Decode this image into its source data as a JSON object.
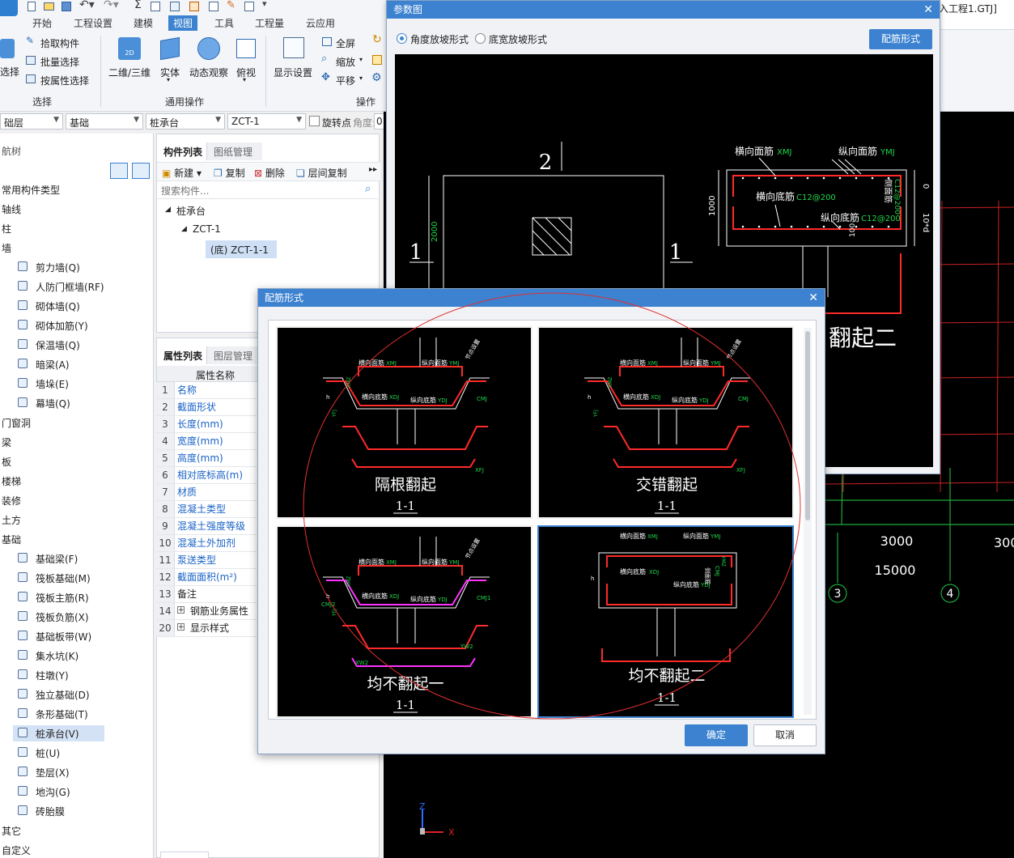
{
  "quick_access": {
    "sigma": "Σ"
  },
  "file_title": "入工程1.GTJ]",
  "tabs": [
    "开始",
    "工程设置",
    "建模",
    "视图",
    "工具",
    "工程量",
    "云应用"
  ],
  "active_tab_index": 3,
  "ribbon": {
    "select_btn": "选择",
    "pick": "拾取构件",
    "batch": "批量选择",
    "by_attr": "按属性选择",
    "group_select": "选择",
    "view_2d3d": "二维/三维",
    "solid": "实体",
    "orbit": "动态观察",
    "top_view": "俯视",
    "group_common": "通用操作",
    "display_settings": "显示设置",
    "fullscreen": "全屏",
    "zoom": "缩放",
    "pan": "平移",
    "group_ops": "操作",
    "icon_2d": "2D"
  },
  "combos": {
    "floor": "础层",
    "category": "基础",
    "type": "桩承台",
    "element": "ZCT-1",
    "rotate_label": "旋转点",
    "angle_label": "角度:",
    "angle_value": "0"
  },
  "nav_tree": {
    "title": "航树",
    "items": [
      {
        "label": "常用构件类型",
        "level": 0
      },
      {
        "label": "轴线",
        "level": 0
      },
      {
        "label": "柱",
        "level": 0
      },
      {
        "label": "墙",
        "level": 0
      },
      {
        "label": "剪力墙(Q)",
        "level": 1
      },
      {
        "label": "人防门框墙(RF)",
        "level": 1
      },
      {
        "label": "砌体墙(Q)",
        "level": 1
      },
      {
        "label": "砌体加筋(Y)",
        "level": 1
      },
      {
        "label": "保温墙(Q)",
        "level": 1
      },
      {
        "label": "暗梁(A)",
        "level": 1
      },
      {
        "label": "墙垛(E)",
        "level": 1
      },
      {
        "label": "幕墙(Q)",
        "level": 1
      },
      {
        "label": "门窗洞",
        "level": 0
      },
      {
        "label": "梁",
        "level": 0
      },
      {
        "label": "板",
        "level": 0
      },
      {
        "label": "楼梯",
        "level": 0
      },
      {
        "label": "装修",
        "level": 0
      },
      {
        "label": "土方",
        "level": 0
      },
      {
        "label": "基础",
        "level": 0
      },
      {
        "label": "基础梁(F)",
        "level": 1
      },
      {
        "label": "筏板基础(M)",
        "level": 1
      },
      {
        "label": "筏板主筋(R)",
        "level": 1
      },
      {
        "label": "筏板负筋(X)",
        "level": 1
      },
      {
        "label": "基础板带(W)",
        "level": 1
      },
      {
        "label": "集水坑(K)",
        "level": 1
      },
      {
        "label": "柱墩(Y)",
        "level": 1
      },
      {
        "label": "独立基础(D)",
        "level": 1
      },
      {
        "label": "条形基础(T)",
        "level": 1
      },
      {
        "label": "桩承台(V)",
        "level": 1
      },
      {
        "label": "桩(U)",
        "level": 1
      },
      {
        "label": "垫层(X)",
        "level": 1
      },
      {
        "label": "地沟(G)",
        "level": 1
      },
      {
        "label": "砖胎膜",
        "level": 1
      },
      {
        "label": "其它",
        "level": 0
      },
      {
        "label": "自定义",
        "level": 0
      }
    ],
    "selected_index": 28
  },
  "component_panel": {
    "tab_list": "构件列表",
    "tab_drawings": "图纸管理",
    "new": "新建",
    "copy": "复制",
    "delete": "删除",
    "floor_copy": "层间复制",
    "search_placeholder": "搜索构件...",
    "tree_root": "桩承台",
    "tree_child": "ZCT-1",
    "tree_leaf": "(底) ZCT-1-1"
  },
  "prop_panel": {
    "tab_props": "属性列表",
    "tab_layers": "图层管理",
    "header": "属性名称",
    "rows": [
      {
        "num": "1",
        "name": "名称",
        "link": true
      },
      {
        "num": "2",
        "name": "截面形状",
        "link": true
      },
      {
        "num": "3",
        "name": "长度(mm)",
        "link": true
      },
      {
        "num": "4",
        "name": "宽度(mm)",
        "link": true
      },
      {
        "num": "5",
        "name": "高度(mm)",
        "link": true
      },
      {
        "num": "6",
        "name": "相对底标高(m)",
        "link": true
      },
      {
        "num": "7",
        "name": "材质",
        "link": true
      },
      {
        "num": "8",
        "name": "混凝土类型",
        "link": true
      },
      {
        "num": "9",
        "name": "混凝土强度等级",
        "link": true
      },
      {
        "num": "10",
        "name": "混凝土外加剂",
        "link": true
      },
      {
        "num": "11",
        "name": "泵送类型",
        "link": true
      },
      {
        "num": "12",
        "name": "截面面积(m²)",
        "link": true
      },
      {
        "num": "13",
        "name": "备注",
        "link": false
      },
      {
        "num": "14",
        "name": "钢筋业务属性",
        "link": false,
        "expand": true
      },
      {
        "num": "20",
        "name": "显示样式",
        "link": false,
        "expand": true
      }
    ]
  },
  "param_dialog": {
    "title": "参数图",
    "radio_angle": "角度放坡形式",
    "radio_width": "底宽放坡形式",
    "rebar_form_btn": "配筋形式",
    "labels": {
      "two": "2",
      "one_left": "1",
      "one_right": "1",
      "dim_2000": "2000",
      "dim_1000": "1000",
      "dim_100": "100",
      "dim_0": "0",
      "dim_10d": "10*d",
      "xmj": "横向面筋",
      "xmj_code": "XMJ",
      "ymj": "纵向面筋",
      "ymj_code": "YMJ",
      "xdj": "横向底筋",
      "xdj_spec": "C12@200",
      "ydj": "纵向底筋",
      "ydj_spec": "C12@200",
      "side": "侧面筋",
      "side_spec": "C12@200",
      "partial_title": "翻起二"
    }
  },
  "rebar_dialog": {
    "title": "配筋形式",
    "ok": "确定",
    "cancel": "取消",
    "options": [
      {
        "title": "隔根翻起",
        "section": "1-1",
        "selected": false
      },
      {
        "title": "交错翻起",
        "section": "1-1",
        "selected": false
      },
      {
        "title": "均不翻起一",
        "section": "1-1",
        "selected": false
      },
      {
        "title": "均不翻起二",
        "section": "1-1",
        "selected": true
      }
    ],
    "mini": {
      "xmj": "横向面筋",
      "xmj_code": "XMJ",
      "ymj": "纵向面筋",
      "ymj_code": "YMJ",
      "xdj": "横向底筋",
      "xdj_code": "XDJ",
      "ydj": "纵向底筋",
      "ydj_code": "YDJ",
      "cmj": "CMJ",
      "cmj1": "CMJ1",
      "cmj2": "CMJ2",
      "xmz": "XMZ",
      "ymz": "YMZ",
      "yfj": "YFJ",
      "xfj": "XFJ",
      "xw2": "XW2",
      "yw2": "YW2",
      "bent": "节点设置",
      "side": "侧面筋",
      "h": "h"
    }
  },
  "canvas": {
    "dim_3000": "3000",
    "dim_3000_cut": "300",
    "dim_15000": "15000",
    "axis_3": "3",
    "axis_4": "4",
    "axis_z": "Z",
    "axis_x": "X"
  }
}
